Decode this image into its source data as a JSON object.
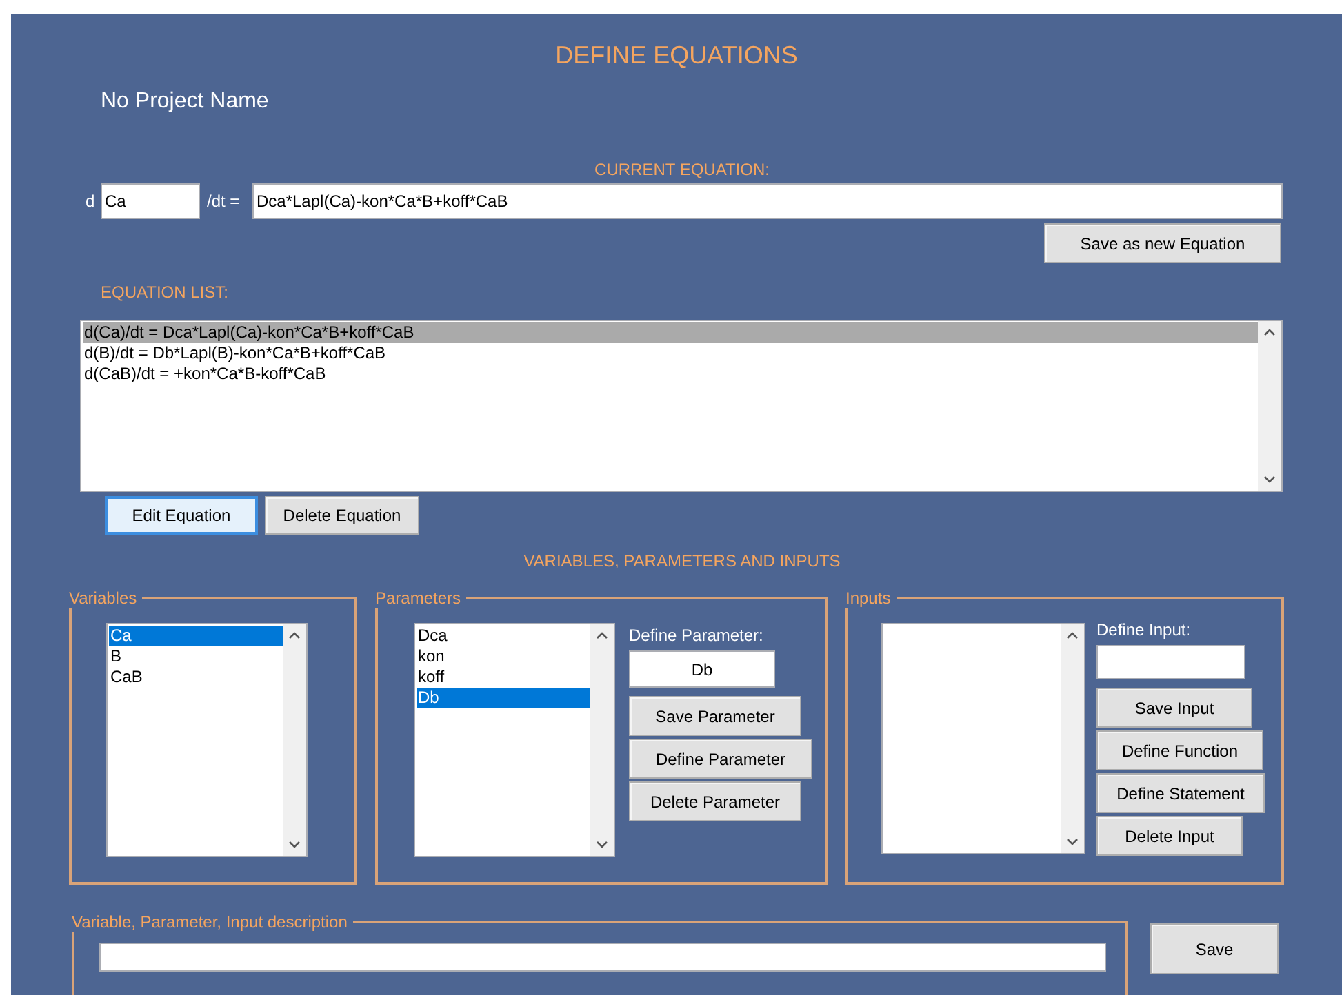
{
  "title": "DEFINE EQUATIONS",
  "project_name": "No Project Name",
  "current_equation": {
    "label": "CURRENT EQUATION:",
    "prefix": "d",
    "variable": "Ca",
    "suffix": "/dt =",
    "expression": "Dca*Lapl(Ca)-kon*Ca*B+koff*CaB",
    "save_button": "Save as new Equation"
  },
  "equation_list": {
    "label": "EQUATION LIST:",
    "items": [
      {
        "text": "d(Ca)/dt = Dca*Lapl(Ca)-kon*Ca*B+koff*CaB",
        "selected": true
      },
      {
        "text": "d(B)/dt = Db*Lapl(B)-kon*Ca*B+koff*CaB",
        "selected": false
      },
      {
        "text": "d(CaB)/dt = +kon*Ca*B-koff*CaB",
        "selected": false
      }
    ],
    "buttons": [
      {
        "label": "Edit Equation",
        "focused": true
      },
      {
        "label": "Delete Equation",
        "focused": false
      }
    ]
  },
  "section_title": "VARIABLES, PARAMETERS AND INPUTS",
  "variables": {
    "label": "Variables",
    "items": [
      {
        "text": "Ca",
        "selected": true
      },
      {
        "text": "B",
        "selected": false
      },
      {
        "text": "CaB",
        "selected": false
      }
    ]
  },
  "parameters": {
    "label": "Parameters",
    "items": [
      {
        "text": "Dca",
        "selected": false
      },
      {
        "text": "kon",
        "selected": false
      },
      {
        "text": "koff",
        "selected": false
      },
      {
        "text": "Db",
        "selected": true
      }
    ],
    "define_label": "Define Parameter:",
    "define_value": "Db",
    "buttons": [
      "Save Parameter",
      "Define Parameter",
      "Delete Parameter"
    ]
  },
  "inputs": {
    "label": "Inputs",
    "define_label": "Define Input:",
    "buttons": [
      "Save Input",
      "Define Function",
      "Define Statement",
      "Delete Input"
    ]
  },
  "description": {
    "label": "Variable, Parameter, Input description",
    "save_button": "Save"
  }
}
